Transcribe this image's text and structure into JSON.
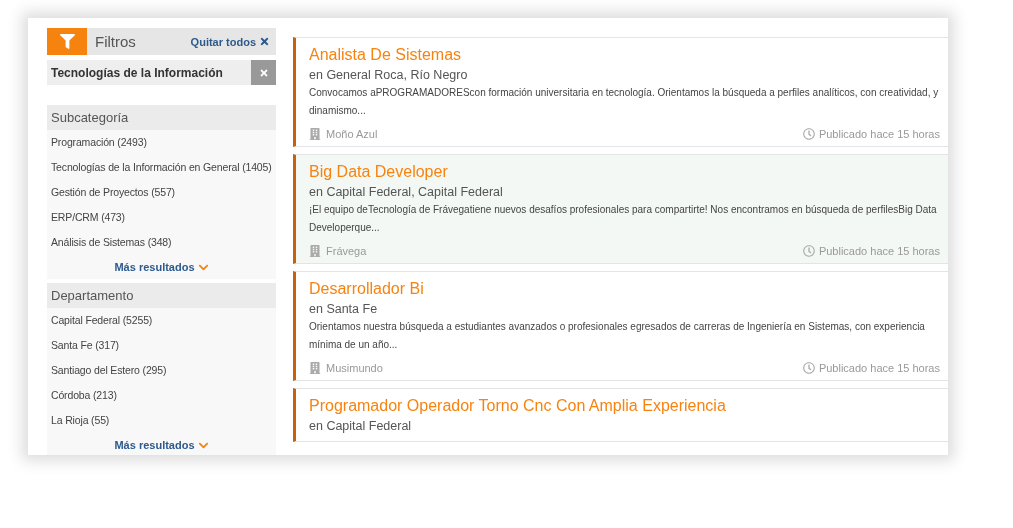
{
  "filters": {
    "title": "Filtros",
    "clear_all": "Quitar todos",
    "active": [
      {
        "label": "Tecnologías de la Información"
      }
    ]
  },
  "facets": [
    {
      "title": "Subcategoría",
      "items": [
        "Programación (2493)",
        "Tecnologías de la Información en General (1405)",
        "Gestión de Proyectos (557)",
        "ERP/CRM (473)",
        "Análisis de Sistemas (348)"
      ],
      "more": "Más resultados"
    },
    {
      "title": "Departamento",
      "items": [
        "Capital Federal (5255)",
        "Santa Fe (317)",
        "Santiago del Estero (295)",
        "Córdoba (213)",
        "La Rioja (55)"
      ],
      "more": "Más resultados"
    }
  ],
  "jobs": [
    {
      "title": "Analista De Sistemas",
      "location": "en General Roca, Río Negro",
      "description": "Convocamos aPROGRAMADOREScon formación universitaria en tecnología. Orientamos la búsqueda a perfiles analíticos, con creatividad, y dinamismo...",
      "company": "Moño Azul",
      "posted": "Publicado hace 15 horas",
      "highlighted": false
    },
    {
      "title": "Big Data Developer",
      "location": "en Capital Federal, Capital Federal",
      "description": "¡El equipo deTecnología de Frávegatiene nuevos desafíos profesionales para compartirte! Nos encontramos en búsqueda de perfilesBig Data Developerque...",
      "company": "Frávega",
      "posted": "Publicado hace 15 horas",
      "highlighted": true
    },
    {
      "title": "Desarrollador Bi",
      "location": "en Santa Fe",
      "description": "Orientamos nuestra búsqueda a estudiantes avanzados o profesionales egresados de carreras de Ingeniería en Sistemas, con experiencia mínima de un año...",
      "company": "Musimundo",
      "posted": "Publicado hace 15 horas",
      "highlighted": false
    },
    {
      "title": "Programador Operador Torno Cnc Con Amplia Experiencia",
      "location": "en Capital Federal",
      "highlighted": false
    }
  ]
}
